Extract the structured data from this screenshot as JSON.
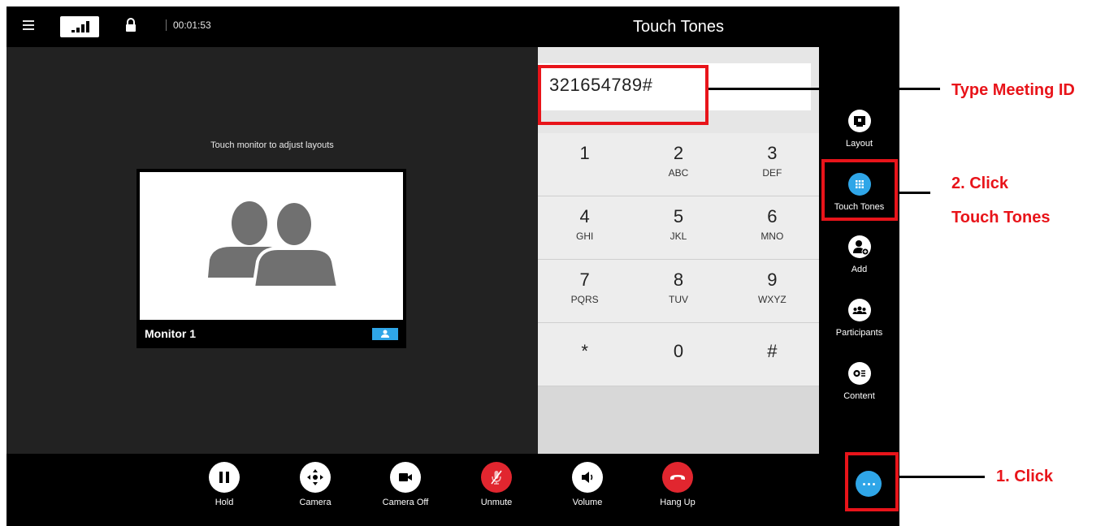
{
  "topbar": {
    "timer": "00:01:53"
  },
  "video": {
    "hint": "Touch monitor to adjust layouts",
    "monitor_label": "Monitor 1"
  },
  "dialer": {
    "title": "Touch Tones",
    "input_value": "321654789#",
    "keys": [
      {
        "digit": "1",
        "letters": ""
      },
      {
        "digit": "2",
        "letters": "ABC"
      },
      {
        "digit": "3",
        "letters": "DEF"
      },
      {
        "digit": "4",
        "letters": "GHI"
      },
      {
        "digit": "5",
        "letters": "JKL"
      },
      {
        "digit": "6",
        "letters": "MNO"
      },
      {
        "digit": "7",
        "letters": "PQRS"
      },
      {
        "digit": "8",
        "letters": "TUV"
      },
      {
        "digit": "9",
        "letters": "WXYZ"
      },
      {
        "digit": "*",
        "letters": ""
      },
      {
        "digit": "0",
        "letters": ""
      },
      {
        "digit": "#",
        "letters": ""
      }
    ]
  },
  "sidebar": {
    "items": [
      {
        "label": "Layout",
        "icon": "layout-icon"
      },
      {
        "label": "Touch Tones",
        "icon": "keypad-icon",
        "active": true
      },
      {
        "label": "Add",
        "icon": "add-person-icon"
      },
      {
        "label": "Participants",
        "icon": "participants-icon"
      },
      {
        "label": "Content",
        "icon": "content-icon"
      }
    ]
  },
  "toolbar": {
    "items": [
      {
        "label": "Hold",
        "icon": "pause-icon"
      },
      {
        "label": "Camera",
        "icon": "camera-move-icon"
      },
      {
        "label": "Camera Off",
        "icon": "video-camera-icon"
      },
      {
        "label": "Unmute",
        "icon": "mic-muted-icon"
      },
      {
        "label": "Volume",
        "icon": "speaker-icon"
      },
      {
        "label": "Hang Up",
        "icon": "phone-hangup-icon"
      }
    ],
    "more_icon": "more-dots-icon"
  },
  "annotations": {
    "type_meeting_id": "Type Meeting ID",
    "step2_line1": "2. Click",
    "step2_line2": "Touch Tones",
    "step1": "1. Click"
  },
  "colors": {
    "accent": "#2fa6e8",
    "annotation_red": "#e8141a",
    "unmute_red": "#e1262f"
  }
}
